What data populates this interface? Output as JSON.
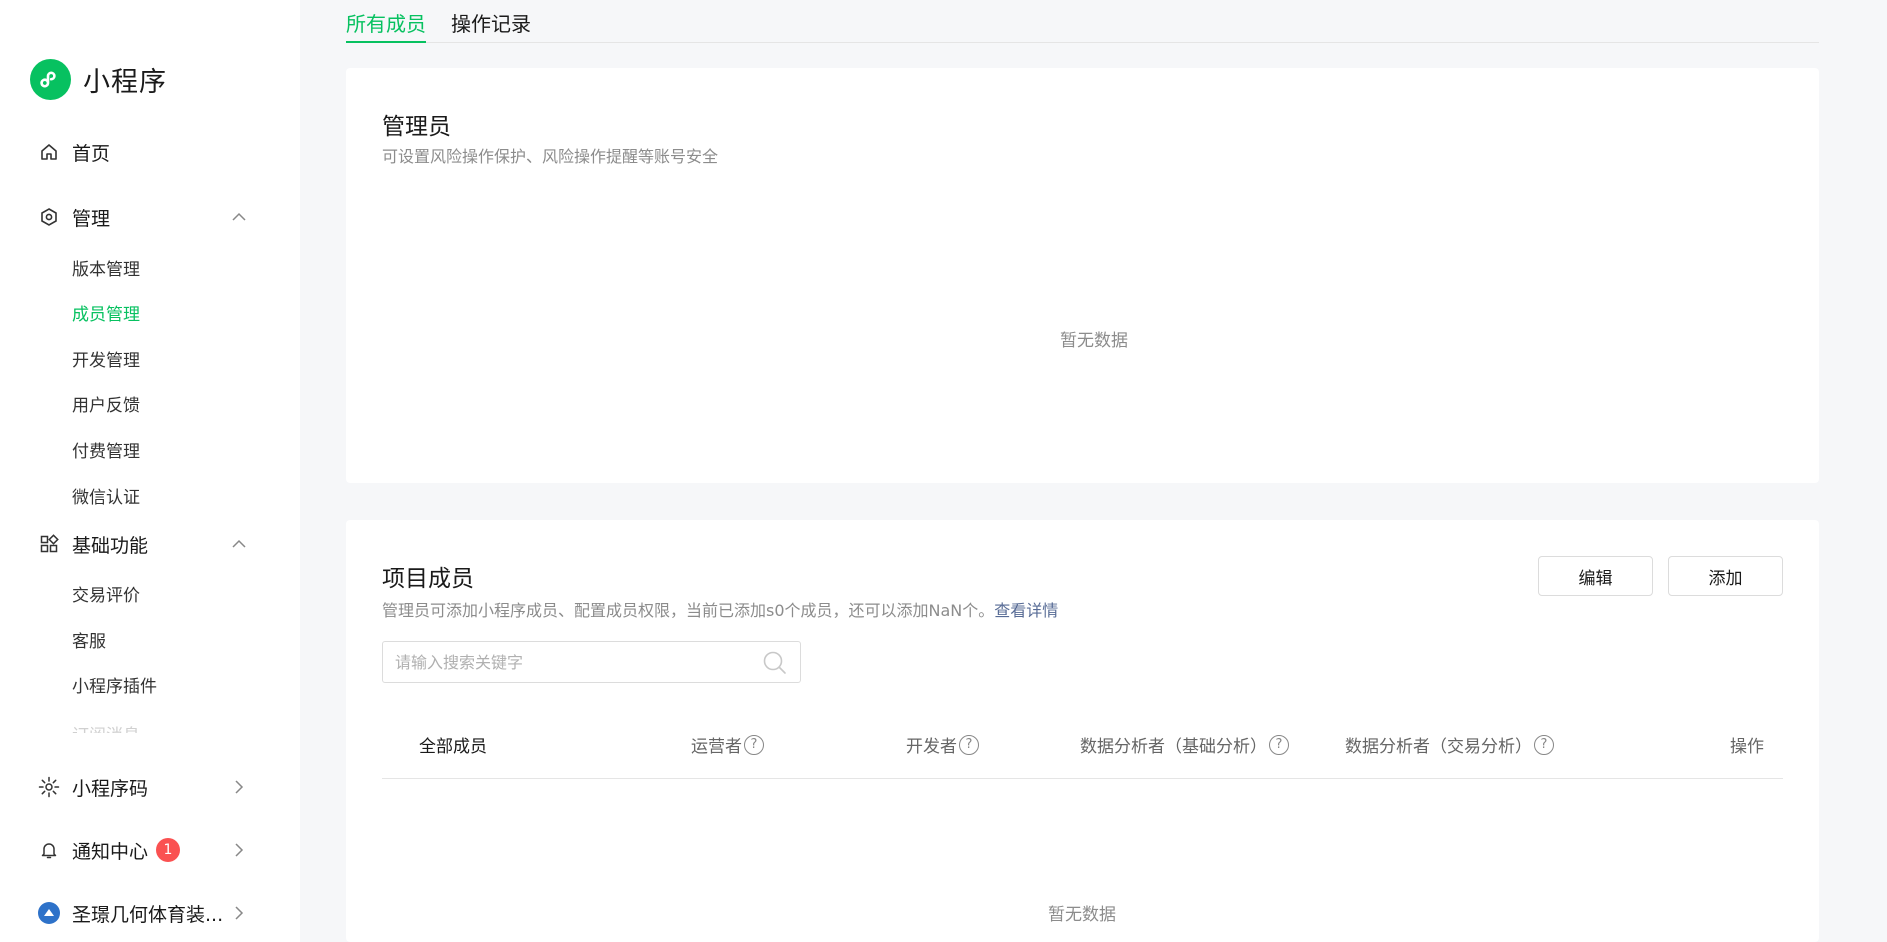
{
  "sidebar": {
    "brand": {
      "name": "小程序",
      "logo_icon": "mini-program-logo-icon",
      "color": "#07c160"
    },
    "nav": {
      "home": {
        "label": "首页",
        "icon": "home-icon"
      },
      "manage": {
        "label": "管理",
        "icon": "hexagon-settings-icon",
        "expanded": true,
        "items": [
          {
            "label": "版本管理"
          },
          {
            "label": "成员管理",
            "active": true
          },
          {
            "label": "开发管理"
          },
          {
            "label": "用户反馈"
          },
          {
            "label": "付费管理"
          },
          {
            "label": "微信认证"
          }
        ]
      },
      "basic": {
        "label": "基础功能",
        "icon": "grid-apps-icon",
        "expanded": true,
        "items": [
          {
            "label": "交易评价"
          },
          {
            "label": "客服"
          },
          {
            "label": "小程序插件"
          },
          {
            "label": "订阅消息"
          }
        ]
      },
      "qrcode": {
        "label": "小程序码",
        "icon": "sun-code-icon"
      },
      "notify": {
        "label": "通知中心",
        "icon": "bell-icon",
        "badge": "1"
      },
      "account": {
        "label": "圣璟几何体育装...",
        "icon": "account-avatar-icon"
      }
    }
  },
  "tabs": [
    {
      "label": "所有成员",
      "active": true
    },
    {
      "label": "操作记录",
      "active": false
    }
  ],
  "admin_card": {
    "title": "管理员",
    "desc": "可设置风险操作保护、风险操作提醒等账号安全",
    "empty": "暂无数据"
  },
  "members_card": {
    "title": "项目成员",
    "desc_prefix": "管理员可添加小程序成员、配置成员权限，当前已添加s0个成员，还可以添加NaN个。",
    "desc_link": "查看详情",
    "edit_label": "编辑",
    "add_label": "添加",
    "search_placeholder": "请输入搜索关键字",
    "columns": [
      {
        "label": "全部成员",
        "help": false
      },
      {
        "label": "运营者",
        "help": true
      },
      {
        "label": "开发者",
        "help": true
      },
      {
        "label": "数据分析者（基础分析）",
        "help": true
      },
      {
        "label": "数据分析者（交易分析）",
        "help": true
      },
      {
        "label": "操作",
        "help": false
      }
    ],
    "empty": "暂无数据"
  },
  "colors": {
    "accent": "#07c160",
    "badge": "#fa5151",
    "link": "#576b95"
  }
}
